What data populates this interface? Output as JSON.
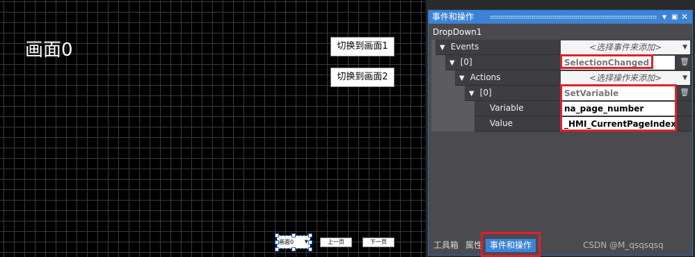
{
  "canvas": {
    "page_title": "画面0",
    "switch_button_1": "切换到画面1",
    "switch_button_2": "切换到画面2",
    "dropdown_value": "画面0",
    "prev_button": "上一页",
    "next_button": "下一页"
  },
  "panel": {
    "title": "事件和操作",
    "object_name": "DropDown1",
    "rows": [
      {
        "name": "Events",
        "value": "<选择事件来添加>"
      },
      {
        "name": "[0]",
        "value": "SelectionChanged"
      },
      {
        "name": "Actions",
        "value": "<选择操作来添加>"
      },
      {
        "name": "[0]",
        "value": "SetVariable"
      },
      {
        "name": "Variable",
        "value": "na_page_number"
      },
      {
        "name": "Value",
        "value": "_HMI_CurrentPageIndex"
      }
    ],
    "tabs": [
      "工具箱",
      "属性",
      "事件和操作"
    ]
  },
  "watermark": "CSDN @M_qsqsqsq",
  "colors": {
    "accent": "#3c83d6",
    "highlight": "#e0202a",
    "canvas_bg": "#000000"
  }
}
